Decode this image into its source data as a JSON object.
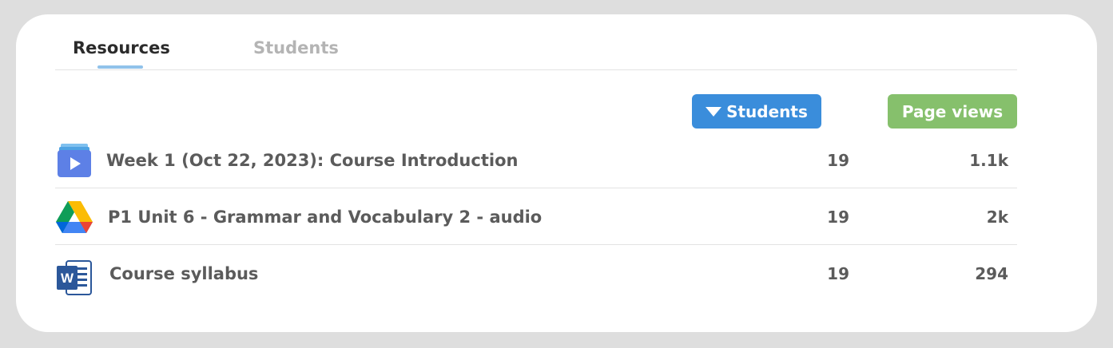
{
  "tabs": [
    {
      "label": "Resources",
      "active": true
    },
    {
      "label": "Students",
      "active": false
    }
  ],
  "columns": {
    "students_label": "Students",
    "students_color": "#3a8ddb",
    "page_views_label": "Page views",
    "page_views_color": "#86c06c",
    "sort_icon": "caret-down-icon"
  },
  "rows": [
    {
      "icon": "video-folder-icon",
      "title": "Week 1 (Oct 22, 2023): Course Introduction",
      "students": "19",
      "page_views": "1.1k"
    },
    {
      "icon": "google-drive-icon",
      "title": "P1 Unit 6 - Grammar and Vocabulary 2 - audio",
      "students": "19",
      "page_views": "2k"
    },
    {
      "icon": "word-document-icon",
      "title": "Course syllabus",
      "students": "19",
      "page_views": "294"
    }
  ]
}
